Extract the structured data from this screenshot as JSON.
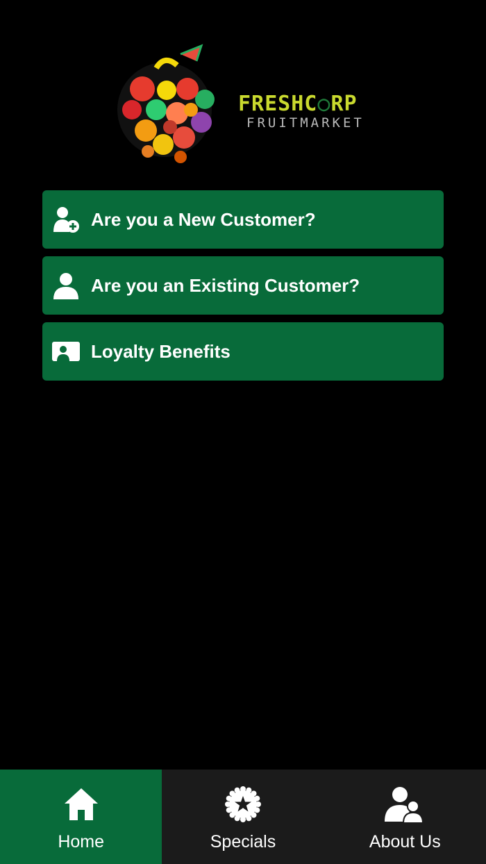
{
  "brand": {
    "name_part1": "FRESHC",
    "name_part2": "RP",
    "subtitle": "FRUITMARKET"
  },
  "menu": [
    {
      "label": "Are you a New Customer?",
      "icon": "add-user-icon"
    },
    {
      "label": "Are you an Existing Customer?",
      "icon": "user-icon"
    },
    {
      "label": "Loyalty Benefits",
      "icon": "loyalty-card-icon"
    }
  ],
  "tabs": [
    {
      "label": "Home",
      "icon": "home-icon",
      "active": true
    },
    {
      "label": "Specials",
      "icon": "star-badge-icon",
      "active": false
    },
    {
      "label": "About Us",
      "icon": "people-icon",
      "active": false
    }
  ],
  "colors": {
    "background": "#000000",
    "accent_green": "#086b3a",
    "tabbar": "#1b1b1b",
    "brand_yellow": "#c9d92e"
  }
}
